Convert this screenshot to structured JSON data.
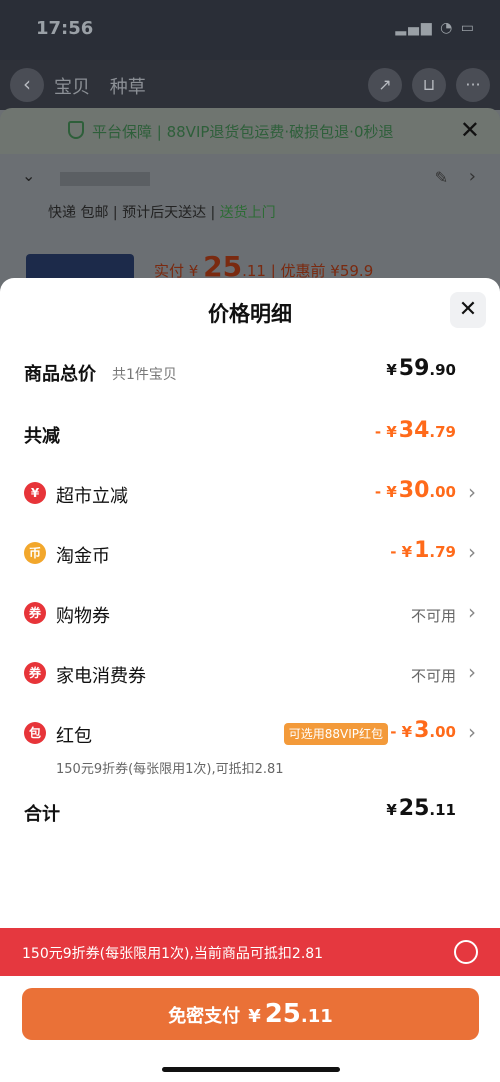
{
  "status_bar": {
    "time": "17:56",
    "icons_text": "▂▄▆ ◔ ▭"
  },
  "nav": {
    "back_icon": "‹",
    "tabs": [
      "宝贝",
      "种草"
    ],
    "share_icon": "↗",
    "cart_icon": "⊔",
    "more_icon": "···"
  },
  "guarantee": {
    "text": "平台保障 | 88VIP退货包运费·破损包退·0秒退",
    "close_icon": "✕"
  },
  "address": {
    "chevron": "⌄",
    "edit_icon": "✎",
    "arrow": "›"
  },
  "delivery": {
    "part1": "快递 包邮 | 预计后天送达 | ",
    "part2": "送货上门"
  },
  "product": {
    "price_prefix": "实付 ¥",
    "price_main": "25",
    "price_dec": ".11",
    "price_suffix": "| 优惠前 ¥59.9"
  },
  "sheet": {
    "title": "价格明细",
    "close_icon": "✕",
    "total_goods": {
      "label": "商品总价",
      "sub": "共1件宝贝",
      "sym": "¥",
      "int": "59",
      "dec": ".90"
    },
    "total_reduction": {
      "label": "共减",
      "sym": "- ¥",
      "int": "34",
      "dec": ".79"
    },
    "items": [
      {
        "name": "超市立减",
        "icon": "¥",
        "sym": "- ¥",
        "int": "30",
        "dec": ".00",
        "chevron": "›"
      },
      {
        "name": "淘金币",
        "icon": "币",
        "sym": "- ¥",
        "int": "1",
        "dec": ".79",
        "chevron": "›"
      },
      {
        "name": "购物券",
        "icon": "券",
        "status": "不可用",
        "chevron": "›"
      },
      {
        "name": "家电消费券",
        "icon": "券",
        "status": "不可用",
        "chevron": "›"
      },
      {
        "name": "红包",
        "icon": "包",
        "tag": "可选用88VIP红包",
        "sym": "- ¥",
        "int": "3",
        "dec": ".00",
        "chevron": "›",
        "note": "150元9折券(每张限用1次),可抵扣2.81"
      }
    ],
    "sum": {
      "label": "合计",
      "sym": "¥",
      "int": "25",
      "dec": ".11"
    }
  },
  "coupon_bar": {
    "text": "150元9折券(每张限用1次),当前商品可抵扣2.81"
  },
  "pay_button": {
    "label": "免密支付",
    "sym": "¥",
    "int": "25",
    "dec": ".11"
  },
  "colors": {
    "accent_orange": "#ff6a1a",
    "coupon_red": "#e5383f",
    "pay_orange": "#ea7137"
  }
}
